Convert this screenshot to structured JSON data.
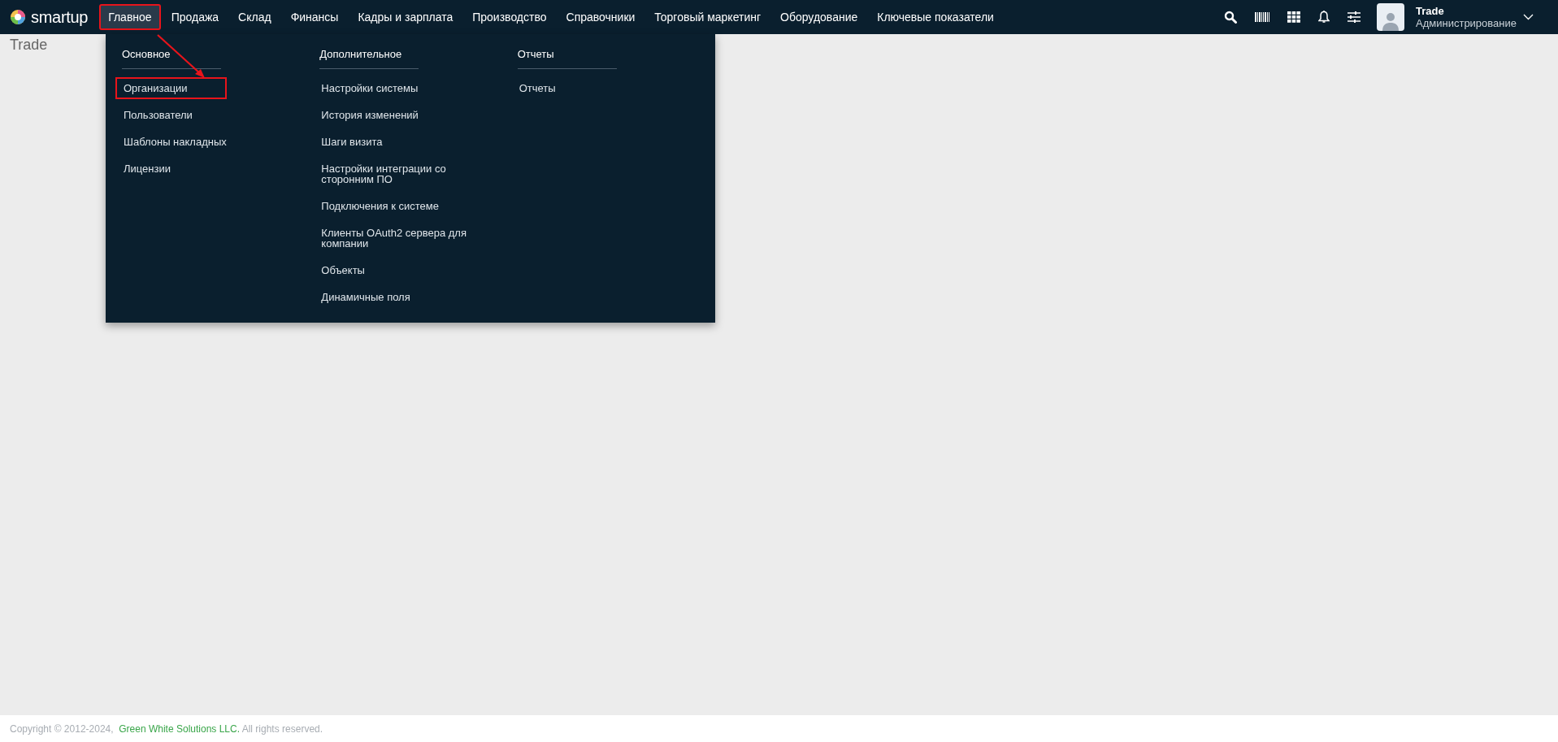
{
  "logo": {
    "text": "smartup"
  },
  "nav": [
    {
      "label": "Главное",
      "selected": true,
      "highlighted": true
    },
    {
      "label": "Продажа",
      "selected": false,
      "highlighted": false
    },
    {
      "label": "Склад",
      "selected": false,
      "highlighted": false
    },
    {
      "label": "Финансы",
      "selected": false,
      "highlighted": false
    },
    {
      "label": "Кадры и зарплата",
      "selected": false,
      "highlighted": false
    },
    {
      "label": "Производство",
      "selected": false,
      "highlighted": false
    },
    {
      "label": "Справочники",
      "selected": false,
      "highlighted": false
    },
    {
      "label": "Торговый маркетинг",
      "selected": false,
      "highlighted": false
    },
    {
      "label": "Оборудование",
      "selected": false,
      "highlighted": false
    },
    {
      "label": "Ключевые показатели",
      "selected": false,
      "highlighted": false
    }
  ],
  "user": {
    "name": "Trade",
    "role": "Администрирование"
  },
  "page_title": "Trade",
  "menu": {
    "annotation_arrow": true,
    "columns": [
      {
        "title": "Основное",
        "items": [
          {
            "label": "Организации",
            "highlighted": true
          },
          {
            "label": "Пользователи",
            "highlighted": false
          },
          {
            "label": "Шаблоны накладных",
            "highlighted": false
          },
          {
            "label": "Лицензии",
            "highlighted": false
          }
        ]
      },
      {
        "title": "Дополнительное",
        "items": [
          {
            "label": "Настройки системы",
            "highlighted": false
          },
          {
            "label": "История изменений",
            "highlighted": false
          },
          {
            "label": "Шаги визита",
            "highlighted": false
          },
          {
            "label": "Настройки интеграции со сторонним ПО",
            "highlighted": false
          },
          {
            "label": "Подключения к системе",
            "highlighted": false
          },
          {
            "label": "Клиенты OAuth2 сервера для компании",
            "highlighted": false
          },
          {
            "label": "Объекты",
            "highlighted": false
          },
          {
            "label": "Динамичные поля",
            "highlighted": false
          }
        ]
      },
      {
        "title": "Отчеты",
        "items": [
          {
            "label": "Отчеты",
            "highlighted": false
          }
        ]
      }
    ]
  },
  "footer": {
    "before": "Copyright © 2012-2024,",
    "link": "Green White Solutions LLC.",
    "after": "All rights reserved."
  }
}
